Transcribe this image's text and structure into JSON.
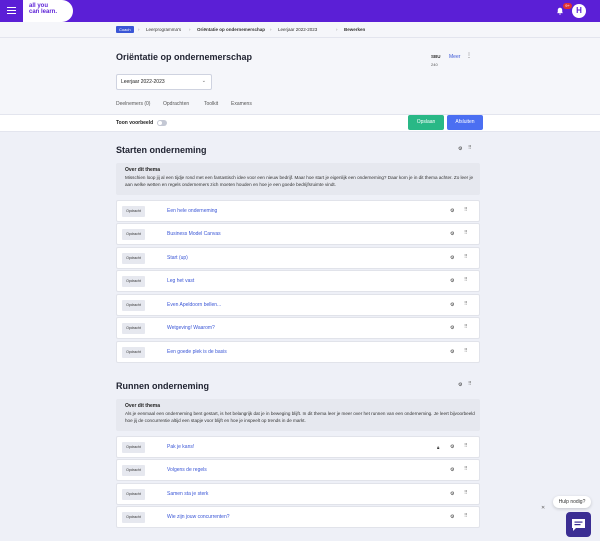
{
  "brand": {
    "logo_lines": [
      "all you",
      "can learn."
    ],
    "logo_line3": "",
    "color": "#5b1fd6"
  },
  "topbar": {
    "notification_count": "9+",
    "avatar_initial": "H"
  },
  "breadcrumb": {
    "home": "Coach",
    "items": [
      "Leerprogramma's",
      "Oriëntatie op ondernemerschap",
      "Leerjaar 2022-2023",
      "Bewerken"
    ]
  },
  "header": {
    "title": "Oriëntatie op ondernemerschap",
    "sbu_label": "SBU",
    "sbu_value": "240",
    "more_label": "Meer"
  },
  "year_select": {
    "value": "Leerjaar 2022-2023"
  },
  "tabs": [
    "Deelnemers (0)",
    "Opdrachten",
    "Toolkit",
    "Examens"
  ],
  "actions": {
    "preview_label": "Toon voorbeeld",
    "save_label": "Opslaan",
    "close_label": "Afsluiten"
  },
  "sections": [
    {
      "title": "Starten onderneming",
      "about_heading": "Over dit thema",
      "about_text": "Misschien loop jij al een tijdje rond met een fantastisch idee voor een nieuw bedrijf. Maar hoe start je eigenlijk een onderneming? Daar kom je in dit thema achter. Zo leer je aan welke wetten en regels ondernemers zich moeten houden en hoe je een goede bedrijfsruimte vindt.",
      "items": [
        {
          "type": "Opdracht",
          "name": "Een hele onderneming"
        },
        {
          "type": "Opdracht",
          "name": "Business Model Canvas"
        },
        {
          "type": "Opdracht",
          "name": "Start (up)"
        },
        {
          "type": "Opdracht",
          "name": "Leg het vast"
        },
        {
          "type": "Opdracht",
          "name": "Even Apeldoorn bellen..."
        },
        {
          "type": "Opdracht",
          "name": "Wetgeving! Waarom?"
        },
        {
          "type": "Opdracht",
          "name": "Een goede plek is de basis"
        }
      ]
    },
    {
      "title": "Runnen onderneming",
      "about_heading": "Over dit thema",
      "about_text": "Als je eenmaal een onderneming bent gestart, is het belangrijk dat je in beweging blijft. In dit thema leer je meer over het runnen van een onderneming. Je leert bijvoorbeeld hoe jij de concurrentie altijd een stapje voor blijft en hoe je inspeelt op trends in de markt.",
      "items": [
        {
          "type": "Opdracht",
          "name": "Pak je kans!"
        },
        {
          "type": "Opdracht",
          "name": "Volgens de regels"
        },
        {
          "type": "Opdracht",
          "name": "Samen sta je sterk"
        },
        {
          "type": "Opdracht",
          "name": "Wie zijn jouw concurrenten?"
        }
      ]
    }
  ],
  "help": {
    "label": "Hulp nodig?"
  }
}
